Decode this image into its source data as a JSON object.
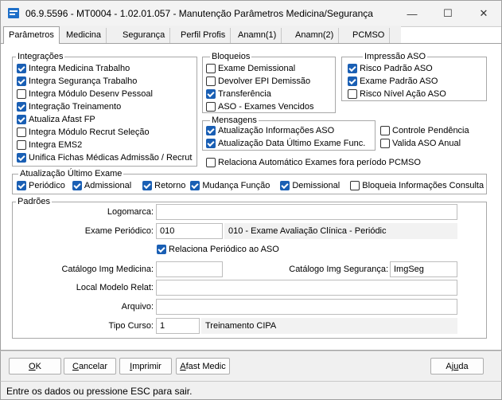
{
  "window": {
    "title": "06.9.5596 - MT0004 - 1.02.01.057 - Manutenção Parâmetros Medicina/Segurança",
    "minimize": "—",
    "maximize": "☐",
    "close": "✕"
  },
  "tabs": [
    {
      "label": "Parâmetros"
    },
    {
      "label": "Medicina"
    },
    {
      "label": "Segurança"
    },
    {
      "label": "Perfil Profis"
    },
    {
      "label": "Anamn(1)"
    },
    {
      "label": "Anamn(2)"
    },
    {
      "label": "PCMSO"
    }
  ],
  "integracoes": {
    "title": "Integrações",
    "items": [
      {
        "label": "Integra Medicina Trabalho",
        "checked": true
      },
      {
        "label": "Integra Segurança Trabalho",
        "checked": true
      },
      {
        "label": "Integra Módulo Desenv Pessoal",
        "checked": false
      },
      {
        "label": "Integração Treinamento",
        "checked": true
      },
      {
        "label": "Atualiza Afast FP",
        "checked": true
      },
      {
        "label": "Integra Módulo Recrut Seleção",
        "checked": false
      },
      {
        "label": "Integra EMS2",
        "checked": false
      },
      {
        "label": "Unifica Fichas Médicas Admissão / Recrut",
        "checked": true
      }
    ]
  },
  "bloqueios": {
    "title": "Bloqueios",
    "items": [
      {
        "label": "Exame Demissional",
        "checked": false
      },
      {
        "label": "Devolver EPI Demissão",
        "checked": false
      },
      {
        "label": "Transferência",
        "checked": true
      },
      {
        "label": "ASO - Exames Vencidos",
        "checked": false
      }
    ]
  },
  "impressao": {
    "title": "Impressão ASO",
    "items": [
      {
        "label": "Risco Padrão ASO",
        "checked": true
      },
      {
        "label": "Exame Padrão ASO",
        "checked": true
      },
      {
        "label": "Risco Nível Ação ASO",
        "checked": false
      }
    ]
  },
  "mensagens": {
    "title": "Mensagens",
    "items": [
      {
        "label": "Atualização Informações ASO",
        "checked": true
      },
      {
        "label": "Atualização Data Último Exame Func.",
        "checked": true
      }
    ]
  },
  "extra": {
    "controle_pendencia": {
      "label": "Controle Pendência",
      "checked": false
    },
    "valida_aso": {
      "label": "Valida ASO Anual",
      "checked": false
    },
    "relaciona_auto": {
      "label": "Relaciona Automático Exames fora período PCMSO",
      "checked": false
    }
  },
  "atualizacao": {
    "title": "Atualização Último Exame",
    "items": [
      {
        "label": "Periódico",
        "checked": true
      },
      {
        "label": "Admissional",
        "checked": true
      },
      {
        "label": "Retorno",
        "checked": true
      },
      {
        "label": "Mudança Função",
        "checked": true
      },
      {
        "label": "Demissional",
        "checked": true
      },
      {
        "label": "Bloqueia Informações Consulta",
        "checked": false
      }
    ]
  },
  "padroes": {
    "title": "Padrões",
    "logomarca": {
      "label": "Logomarca:",
      "value": ""
    },
    "exame_periodico": {
      "label": "Exame Periódico:",
      "code": "010",
      "desc": "010 - Exame Avaliação Clínica - Periódic"
    },
    "relaciona_periodico": {
      "label": "Relaciona Periódico ao ASO",
      "checked": true
    },
    "catalogo_medicina": {
      "label": "Catálogo Img Medicina:",
      "value": ""
    },
    "catalogo_seguranca": {
      "label": "Catálogo Img Segurança:",
      "value": "ImgSeg"
    },
    "local_modelo": {
      "label": "Local Modelo Relat:",
      "value": ""
    },
    "arquivo": {
      "label": "Arquivo:",
      "value": ""
    },
    "tipo_curso": {
      "label": "Tipo Curso:",
      "code": "1",
      "desc": "Treinamento CIPA"
    }
  },
  "buttons": {
    "ok": {
      "pre": "",
      "key": "O",
      "post": "K"
    },
    "cancelar": {
      "pre": "",
      "key": "C",
      "post": "ancelar"
    },
    "imprimir": {
      "pre": "",
      "key": "I",
      "post": "mprimir"
    },
    "afast": {
      "pre": "",
      "key": "A",
      "post": "fast Medic"
    },
    "ajuda": {
      "pre": "Aj",
      "key": "u",
      "post": "da"
    }
  },
  "status": "Entre os dados ou pressione ESC para sair."
}
